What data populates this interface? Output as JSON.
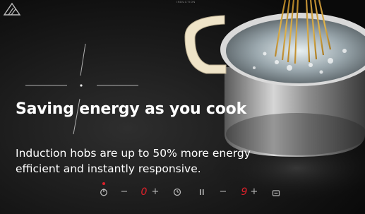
{
  "hero": {
    "headline": "Saving energy as you cook",
    "subtext": "Induction hobs are up to 50% more energy efficient and instantly responsive.",
    "top_label": "INDUCTION"
  },
  "controls": {
    "power_icon": "power-icon",
    "minus_left": "−",
    "zone_left_level": "0",
    "plus_left": "+",
    "timer_icon": "timer-icon",
    "pause_icon": "pause-icon",
    "minus_right": "−",
    "zone_right_level": "9",
    "plus_right": "+",
    "lock_icon": "lock-icon"
  },
  "colors": {
    "indicator_red": "#e0202a",
    "pot_steel": "#c9c9c9",
    "handle_cream": "#efe4c8"
  }
}
